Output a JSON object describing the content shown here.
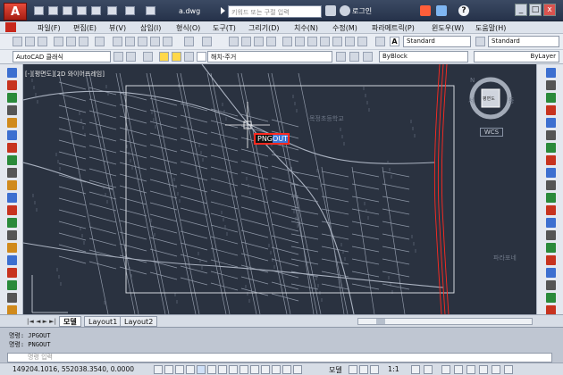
{
  "window": {
    "title": "a.dwg",
    "logo": "A"
  },
  "search": {
    "placeholder": "키워드 또는 구절 입력"
  },
  "user": {
    "login_label": "로그인"
  },
  "menu": [
    "파일(F)",
    "편집(E)",
    "뷰(V)",
    "삽입(I)",
    "형식(O)",
    "도구(T)",
    "그리기(D)",
    "치수(N)",
    "수정(M)",
    "파라메트릭(P)",
    "윈도우(W)",
    "도움말(H)"
  ],
  "toolbar": {
    "text_style": "Standard",
    "dim_style": "Standard",
    "workspace": "AutoCAD 클래식",
    "layer": "해치-주거",
    "color": "ByBlock",
    "linetype": "ByLayer"
  },
  "viewport": {
    "label": "[-][평면도][2D 와이어프레임]"
  },
  "viewcube": {
    "top_label": "N",
    "left_label": "서",
    "right_label": "동",
    "face_label": "평면도",
    "wcs_label": "WCS"
  },
  "overlay": {
    "png": "PNG",
    "out": "OUT"
  },
  "map_labels": {
    "school": "목정초등학교",
    "right": "파라포네"
  },
  "tabs": {
    "model": "모델",
    "layout1": "Layout1",
    "layout2": "Layout2"
  },
  "command": {
    "history": [
      "명령: JPGOUT",
      "명령: PNGOUT"
    ],
    "placeholder": "명령 입력"
  },
  "status": {
    "coordinates": "149204.1016, 552038.3540, 0.0000",
    "model": "모델",
    "scale": "1:1"
  },
  "colors": {
    "accent": "#3c77d8",
    "highlight": "#ff2a20",
    "canvas": "#2a3240"
  }
}
